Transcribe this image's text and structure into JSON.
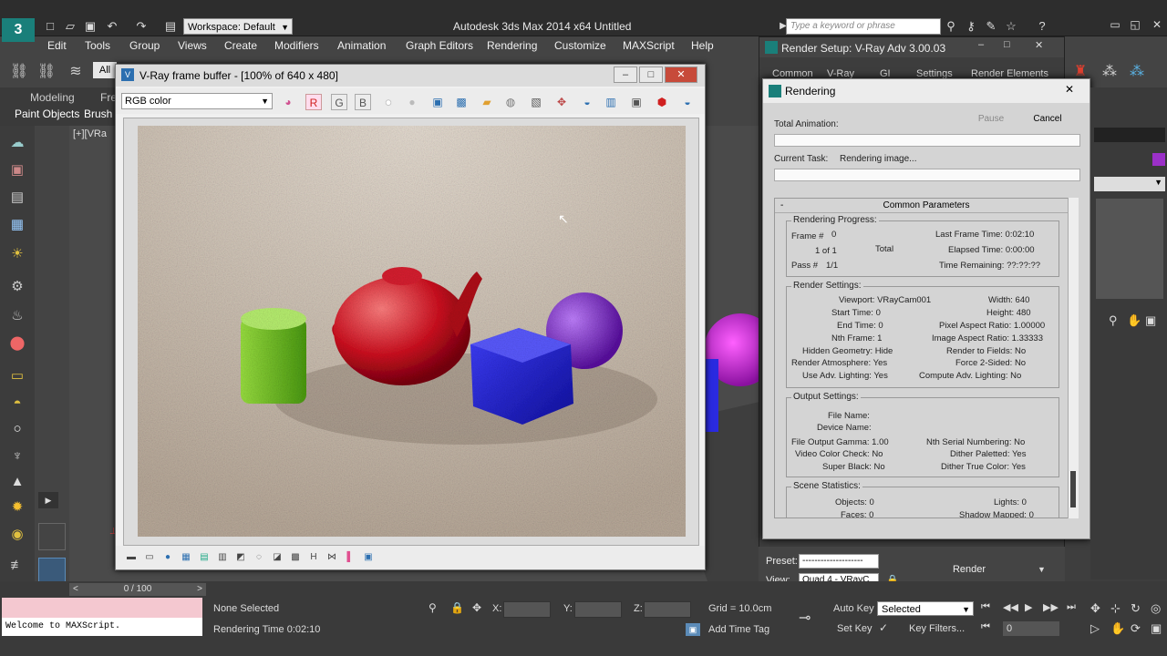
{
  "app": {
    "title": "Autodesk 3ds Max  2014 x64      Untitled",
    "logo": "3",
    "workspace": "Workspace: Default",
    "search_placeholder": "Type a keyword or phrase"
  },
  "menu": [
    "Edit",
    "Tools",
    "Group",
    "Views",
    "Create",
    "Modifiers",
    "Animation",
    "Graph Editors",
    "Rendering",
    "Customize",
    "MAXScript",
    "Help"
  ],
  "ribbon": {
    "tab1": "Modeling",
    "tab2": "Fre",
    "sub1": "Paint Objects",
    "sub2": "Brush"
  },
  "toolbar_filter": "All",
  "viewport": {
    "label": "[+][VRa"
  },
  "vfb": {
    "title": "V-Ray frame buffer - [100% of 640 x 480]",
    "channel": "RGB color",
    "r": "R",
    "g": "G",
    "b": "B"
  },
  "render_setup": {
    "title": "Render Setup: V-Ray Adv 3.00.03",
    "tabs": [
      "Common",
      "V-Ray",
      "GI",
      "Settings",
      "Render Elements"
    ],
    "preset_label": "Preset:",
    "preset_value": "--------------------",
    "view_label": "View:",
    "view_value": "Quad 4 - VRayC",
    "render_button": "Render"
  },
  "rendering": {
    "title": "Rendering",
    "total_animation": "Total Animation:",
    "pause": "Pause",
    "cancel": "Cancel",
    "current_task_label": "Current Task:",
    "current_task": "Rendering image...",
    "common_parameters": "Common Parameters",
    "progress_group": "Rendering Progress:",
    "frame_label": "Frame #",
    "frame_value": "0",
    "of": "1 of 1",
    "total": "Total",
    "pass_label": "Pass #",
    "pass_value": "1/1",
    "last_frame_time": "Last Frame Time:  0:02:10",
    "elapsed_time": "Elapsed Time:  0:00:00",
    "time_remaining": "Time Remaining:  ??:??:??",
    "render_settings_group": "Render Settings:",
    "viewport": "Viewport:  VRayCam001",
    "width": "Width:  640",
    "start_time": "Start Time:  0",
    "height": "Height:  480",
    "end_time": "End Time:  0",
    "pixel_aspect": "Pixel Aspect Ratio:  1.00000",
    "nth_frame": "Nth Frame:  1",
    "image_aspect": "Image Aspect Ratio:  1.33333",
    "hidden_geometry": "Hidden Geometry:  Hide",
    "render_to_fields": "Render to Fields:  No",
    "render_atmosphere": "Render Atmosphere:  Yes",
    "force_2sided": "Force 2-Sided:  No",
    "use_adv_lighting": "Use Adv. Lighting:  Yes",
    "compute_adv_lighting": "Compute Adv. Lighting:  No",
    "output_group": "Output Settings:",
    "file_name": "File Name:",
    "device_name": "Device Name:",
    "file_output_gamma": "File Output Gamma:  1.00",
    "nth_serial": "Nth Serial Numbering:  No",
    "video_color_check": "Video Color Check:  No",
    "dither_paletted": "Dither Paletted:  Yes",
    "super_black": "Super Black:  No",
    "dither_true_color": "Dither True Color:  Yes",
    "scene_group": "Scene Statistics:",
    "objects": "Objects:  0",
    "lights": "Lights:  0",
    "faces": "Faces:  0",
    "shadow_mapped": "Shadow Mapped:  0"
  },
  "status": {
    "time_slider": "0 / 100",
    "listener": "Welcome to MAXScript.",
    "selection": "None Selected",
    "rendering_time": "Rendering Time  0:02:10",
    "x": "X:",
    "y": "Y:",
    "z": "Z:",
    "grid": "Grid = 10.0cm",
    "add_time_tag": "Add Time Tag",
    "auto_key": "Auto Key",
    "selected": "Selected",
    "set_key": "Set Key",
    "key_filters": "Key Filters...",
    "frame_value": "0"
  },
  "colors": {
    "teal": "#1a7f7a",
    "close_red": "#c74a3a"
  }
}
